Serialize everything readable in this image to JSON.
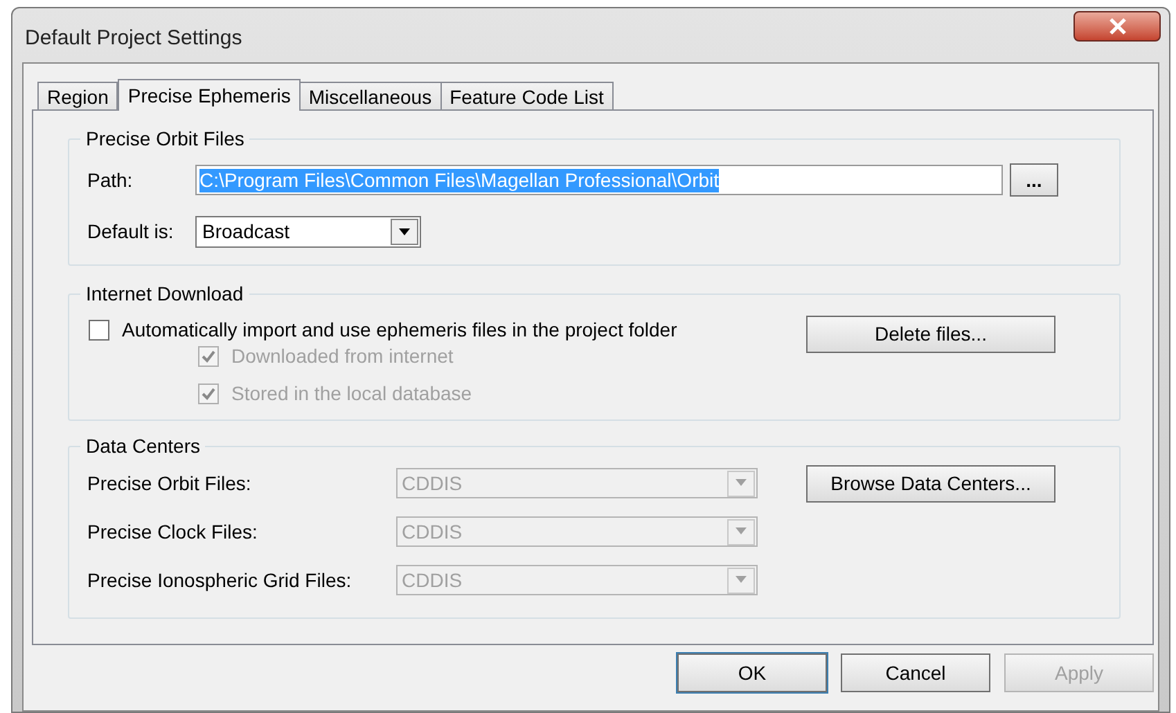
{
  "window": {
    "title": "Default Project Settings"
  },
  "tabs": [
    {
      "label": "Region",
      "selected": false
    },
    {
      "label": "Precise Ephemeris",
      "selected": true
    },
    {
      "label": "Miscellaneous",
      "selected": false
    },
    {
      "label": "Feature Code List",
      "selected": false
    }
  ],
  "precise_orbit_files": {
    "title": "Precise Orbit Files",
    "path_label": "Path:",
    "path_value": "C:\\Program Files\\Common Files\\Magellan Professional\\Orbit",
    "path_text_selected": true,
    "browse_button": "...",
    "default_label": "Default is:",
    "default_value": "Broadcast"
  },
  "internet_download": {
    "title": "Internet Download",
    "auto_import": {
      "label": "Automatically import and use ephemeris files in the project folder",
      "checked": false
    },
    "sub_options": [
      {
        "label": "Downloaded from internet",
        "checked": true,
        "disabled": true
      },
      {
        "label": "Stored in the local database",
        "checked": true,
        "disabled": true
      }
    ],
    "delete_button": "Delete files..."
  },
  "data_centers": {
    "title": "Data Centers",
    "rows": [
      {
        "label": "Precise Orbit Files:",
        "value": "CDDIS",
        "disabled": true
      },
      {
        "label": "Precise Clock Files:",
        "value": "CDDIS",
        "disabled": true
      },
      {
        "label": "Precise Ionospheric Grid Files:",
        "value": "CDDIS",
        "disabled": true
      }
    ],
    "browse_button": "Browse Data Centers..."
  },
  "buttons": [
    {
      "label": "OK",
      "disabled": false
    },
    {
      "label": "Cancel",
      "disabled": false
    },
    {
      "label": "Apply",
      "disabled": true
    }
  ]
}
